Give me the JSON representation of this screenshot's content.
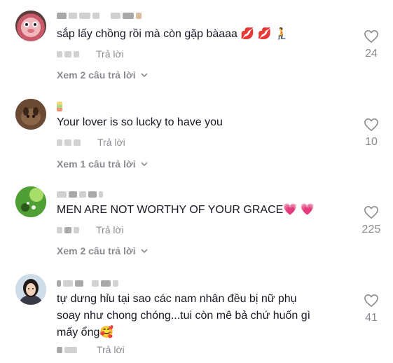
{
  "comments": [
    {
      "text": "sắp lấy chồng rồi mà còn gặp bàaaa 💋 💋 🧎",
      "reply_label": "Trả lời",
      "likes": "24",
      "view_replies": "Xem 2 câu trả lời"
    },
    {
      "text": "Your lover is so lucky to have you",
      "reply_label": "Trả lời",
      "likes": "10",
      "view_replies": "Xem 1 câu trả lời"
    },
    {
      "text": "MEN ARE NOT WORTHY OF YOUR GRACE💗 💗",
      "reply_label": "Trả lời",
      "likes": "225",
      "view_replies": "Xem 2 câu trả lời"
    },
    {
      "text_lines": [
        "tự dưng hỉu tại sao các nam nhân đều bị nữ phụ",
        "soay như chong chóng...tui còn mê bả chứ huốn gì",
        "mấy ổng🥰"
      ],
      "reply_label": "Trả lời",
      "likes": "41"
    }
  ],
  "icons": {
    "like": "heart-outline-icon",
    "expand": "chevron-down-icon"
  },
  "colors": {
    "text": "#161823",
    "secondary": "#8a8b91"
  }
}
